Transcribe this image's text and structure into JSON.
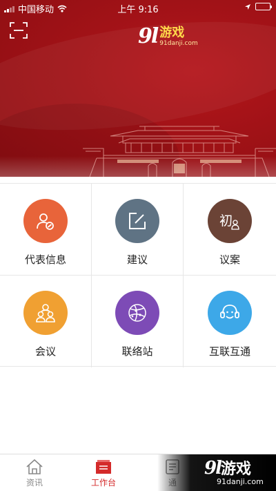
{
  "status_bar": {
    "carrier": "中国移动",
    "time": "上午 9:16"
  },
  "banner": {
    "brand_number": "9l",
    "brand_name": "游戏",
    "brand_url": "91danji.com"
  },
  "grid": {
    "items": [
      {
        "label": "代表信息",
        "icon": "representative-person-icon",
        "color": "#e8643a"
      },
      {
        "label": "建议",
        "icon": "edit-pen-icon",
        "color": "#5f7384"
      },
      {
        "label": "议案",
        "icon": "proposal-chu-icon",
        "color": "#6b4336"
      },
      {
        "label": "会议",
        "icon": "meeting-people-icon",
        "color": "#f0a032"
      },
      {
        "label": "联络站",
        "icon": "network-globe-icon",
        "color": "#7d4bb6"
      },
      {
        "label": "互联互通",
        "icon": "headset-support-icon",
        "color": "#3da8e8"
      }
    ]
  },
  "tab_bar": {
    "tabs": [
      {
        "label": "资讯",
        "icon": "home-icon",
        "active": false
      },
      {
        "label": "工作台",
        "icon": "workbench-folder-icon",
        "active": true
      },
      {
        "label": "通",
        "icon": "contacts-icon",
        "active": false
      }
    ]
  },
  "watermark": {
    "number": "9l",
    "name": "游戏",
    "url": "91danji.com"
  },
  "colors": {
    "banner_red": "#a11217",
    "active_tab": "#d42a2a",
    "battery_green": "#39d353"
  }
}
